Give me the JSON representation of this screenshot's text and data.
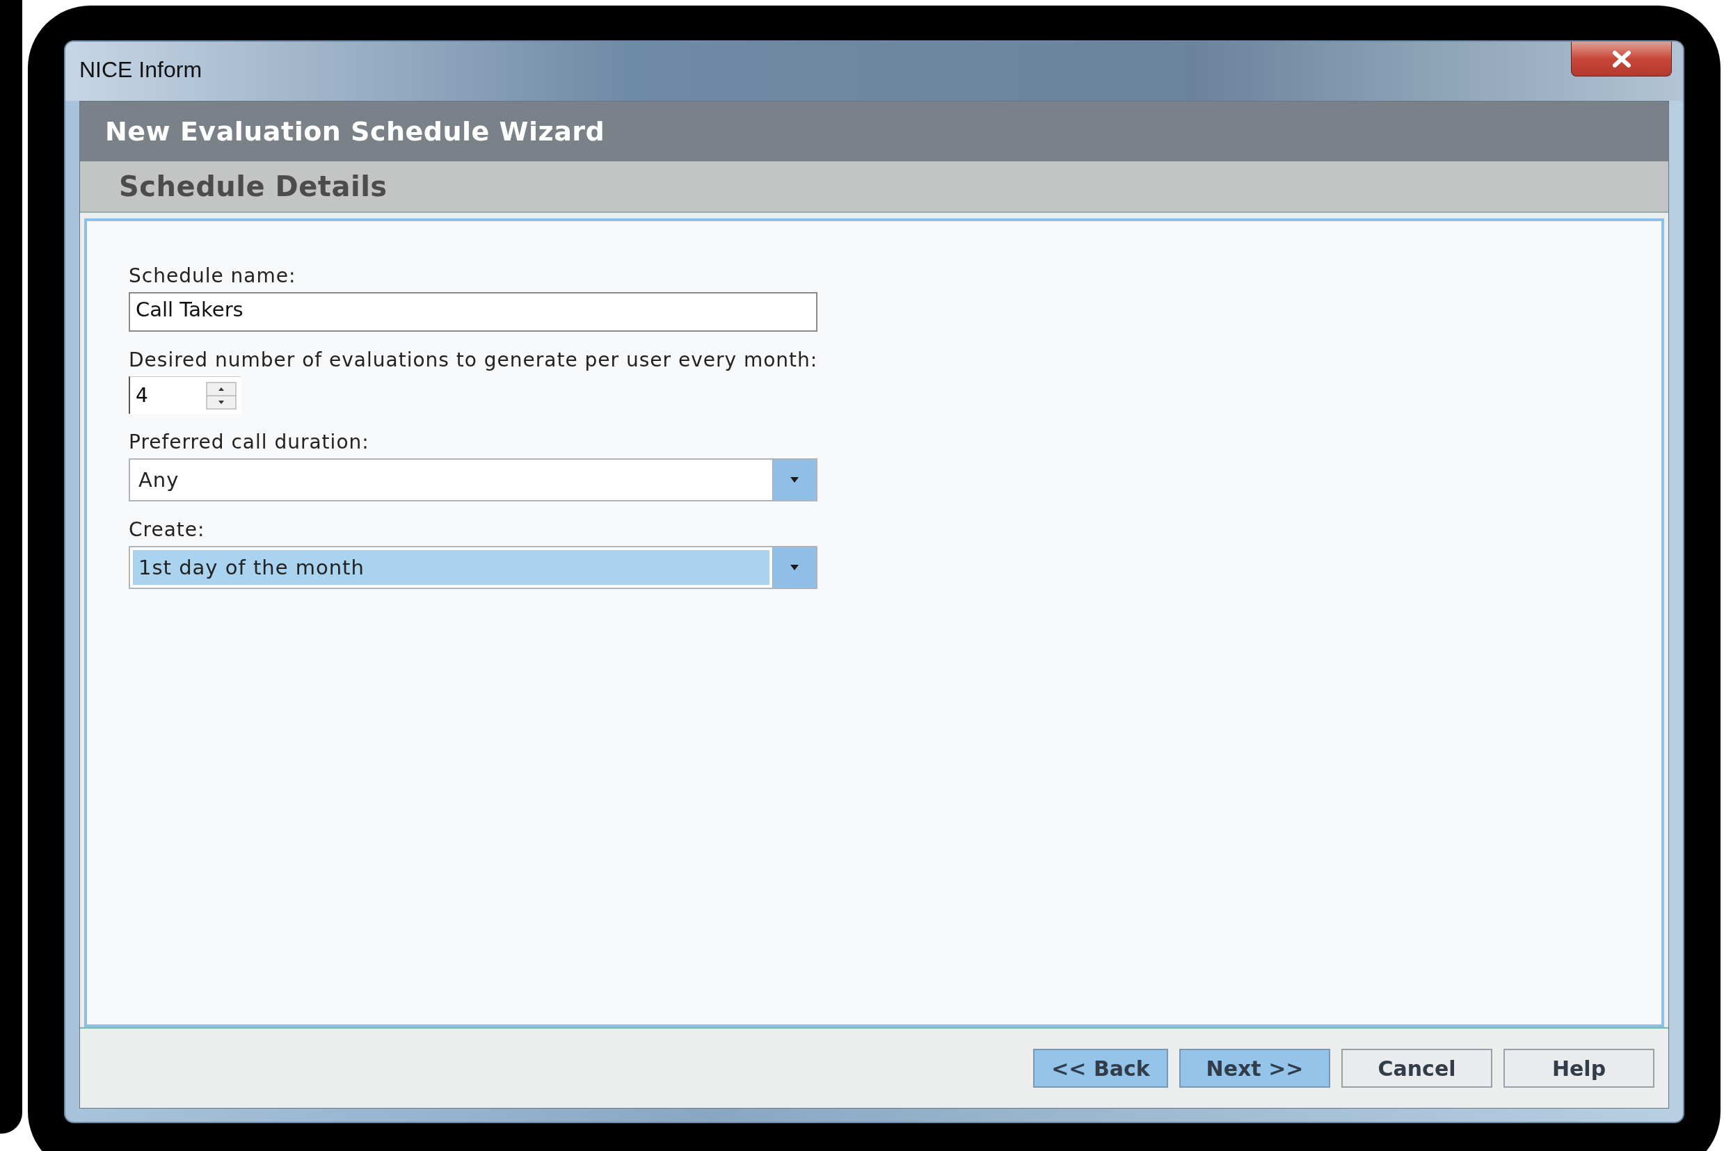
{
  "window": {
    "title": "NICE Inform"
  },
  "wizard": {
    "title": "New Evaluation Schedule Wizard",
    "step": "Schedule Details"
  },
  "fields": [
    {
      "kind": "text",
      "label": "Schedule name:",
      "value": "Call Takers"
    },
    {
      "kind": "spinner",
      "label": "Desired number of evaluations to generate per user every month:",
      "value": "4"
    },
    {
      "kind": "dropdown",
      "label": "Preferred call duration:",
      "value": "Any",
      "focused": false
    },
    {
      "kind": "dropdown",
      "label": "Create:",
      "value": "1st day of the month",
      "focused": true
    }
  ],
  "buttons": [
    {
      "label": "<< Back",
      "highlighted": true
    },
    {
      "label": "Next >>",
      "highlighted": true
    },
    {
      "label": "Cancel",
      "highlighted": false
    },
    {
      "label": "Help",
      "highlighted": false
    }
  ]
}
